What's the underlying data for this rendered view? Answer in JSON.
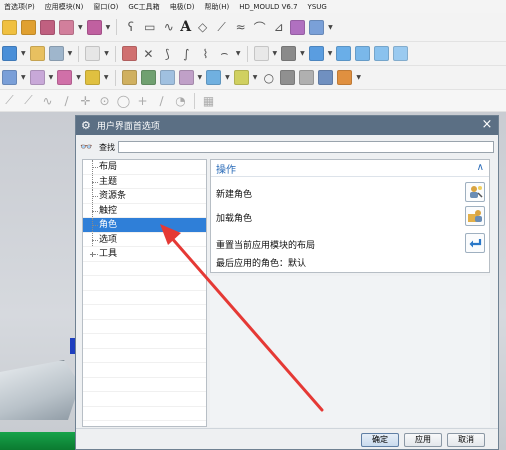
{
  "menubar": {
    "items": [
      "首选项(P)",
      "应用模块(N)",
      "窗口(O)",
      "GC工具箱",
      "电极(D)",
      "帮助(H)",
      "HD_MOULD V6.7",
      "YSUG"
    ]
  },
  "toolbar": {
    "text_tool_glyph": "A"
  },
  "dialog": {
    "title": "用户界面首选项",
    "close_glyph": "×",
    "search": {
      "label": "查找",
      "value": "",
      "placeholder": ""
    },
    "tree": {
      "items": [
        {
          "label": "布局",
          "selected": false,
          "expandable": false
        },
        {
          "label": "主题",
          "selected": false,
          "expandable": false
        },
        {
          "label": "资源条",
          "selected": false,
          "expandable": false
        },
        {
          "label": "触控",
          "selected": false,
          "expandable": false
        },
        {
          "label": "角色",
          "selected": true,
          "expandable": false
        },
        {
          "label": "选项",
          "selected": false,
          "expandable": false
        },
        {
          "label": "工具",
          "selected": false,
          "expandable": true
        }
      ]
    },
    "operations": {
      "header": "操作",
      "collapse_glyph": "∧",
      "new_role": "新建角色",
      "load_role": "加载角色",
      "reset_layout": "重置当前应用模块的布局",
      "last_role": "最后应用的角色：默认"
    },
    "buttons": {
      "ok": "确定",
      "apply": "应用",
      "cancel": "取消"
    }
  },
  "colors": {
    "titlebar": "#5b6f84",
    "selection": "#2f7fd8",
    "header_text": "#2a6bb8",
    "annotation_arrow": "#e53935"
  }
}
